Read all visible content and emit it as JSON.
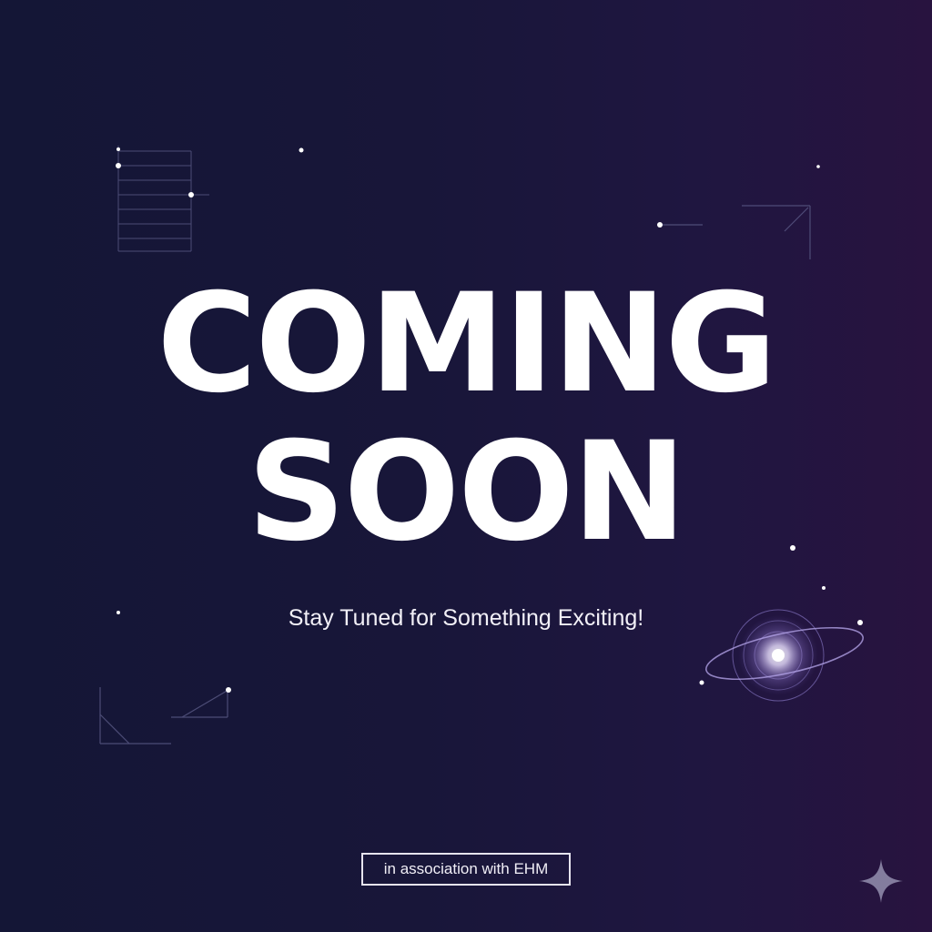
{
  "headline": {
    "line1": "COMING",
    "line2": "SOON"
  },
  "tagline": "Stay Tuned for Something Exciting!",
  "association": "in association with EHM",
  "colors": {
    "background_start": "#141636",
    "background_end": "#28133f",
    "text": "#ffffff",
    "accent_glow": "#c9b8ff"
  },
  "icons": [
    "planet-icon",
    "sparkle-icon"
  ]
}
